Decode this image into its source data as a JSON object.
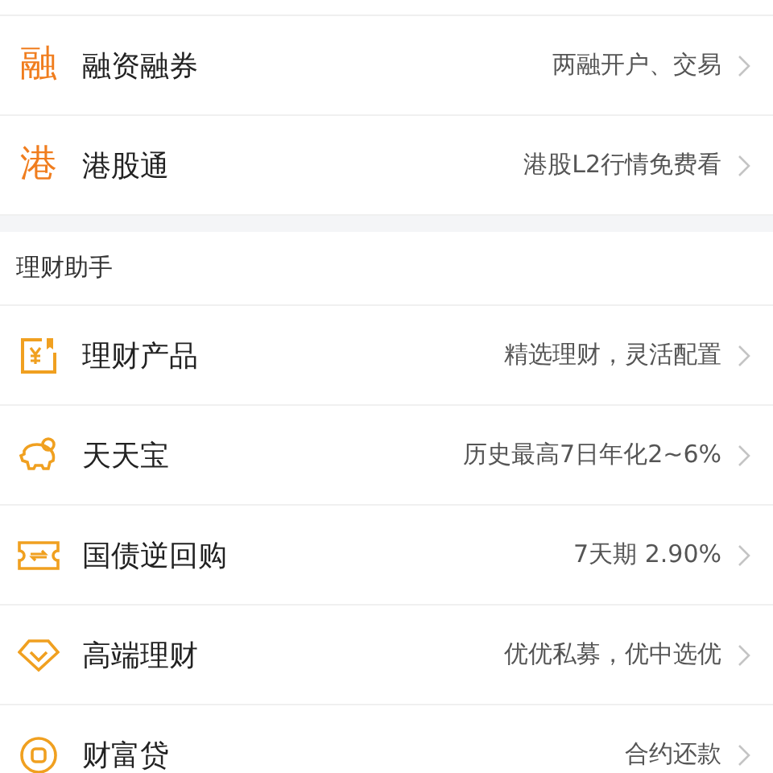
{
  "top_menu": [
    {
      "kind": "glyph",
      "glyph": "融",
      "title": "融资融券",
      "detail": "两融开户、交易"
    },
    {
      "kind": "glyph",
      "glyph": "港",
      "title": "港股通",
      "detail": "港股L2行情免费看"
    }
  ],
  "section": {
    "title": "理财助手",
    "items": [
      {
        "kind": "yen",
        "title": "理财产品",
        "detail": "精选理财，灵活配置"
      },
      {
        "kind": "piggy",
        "title": "天天宝",
        "detail": "历史最高7日年化2~6%"
      },
      {
        "kind": "ticket",
        "title": "国债逆回购",
        "detail": "7天期 2.90%"
      },
      {
        "kind": "diamond",
        "title": "高端理财",
        "detail": "优优私募，优中选优"
      },
      {
        "kind": "coin",
        "title": "财富贷",
        "detail": "合约还款"
      }
    ]
  }
}
